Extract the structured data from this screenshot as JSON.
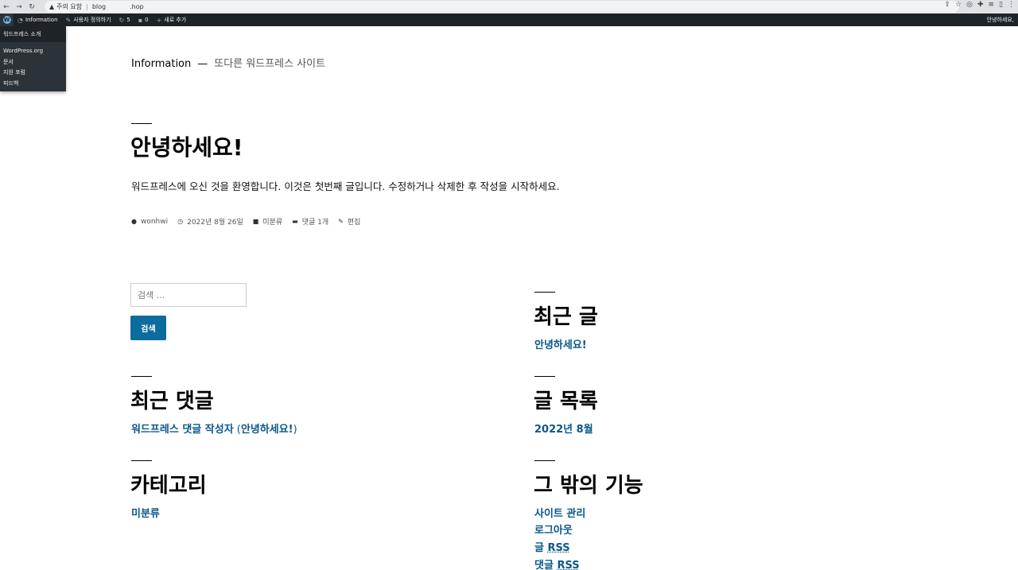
{
  "browser": {
    "warning": "주의 요함",
    "url_left": "blog",
    "url_right": ".hop"
  },
  "adminbar": {
    "site": "Information",
    "customize": "사용자 정의하기",
    "updates": "5",
    "comments": "0",
    "new": "새로 추가",
    "greeting": "안녕하세요,"
  },
  "wpmenu": {
    "about": "워드프레스 소개",
    "items": [
      "WordPress.org",
      "문서",
      "지원 포럼",
      "피드백"
    ]
  },
  "header": {
    "site_title": "Information",
    "separator": "—",
    "description": "또다른 워드프레스 사이트"
  },
  "post": {
    "title": "안녕하세요!",
    "content": "워드프레스에 오신 것을 환영합니다. 이것은 첫번째 글입니다. 수정하거나 삭제한 후 작성을 시작하세요.",
    "meta": {
      "author": "wonhwi",
      "date": "2022년 8월 26일",
      "category": "미분류",
      "comments": "댓글 1개",
      "edit": "편집"
    }
  },
  "search": {
    "placeholder": "검색 ...",
    "button": "검색"
  },
  "widgets": {
    "recent_posts": {
      "title": "최근 글",
      "items": [
        "안녕하세요!"
      ]
    },
    "recent_comments": {
      "title": "최근 댓글",
      "author": "워드프레스 댓글 작성자",
      "on": " (",
      "post": "안녕하세요!",
      "close": ")"
    },
    "archives": {
      "title": "글 목록",
      "items": [
        "2022년 8월"
      ]
    },
    "categories": {
      "title": "카테고리",
      "items": [
        "미분류"
      ]
    },
    "meta": {
      "title": "그 밖의 기능",
      "site_admin": "사이트 관리",
      "logout": "로그아웃",
      "posts_rss_a": "글 ",
      "posts_rss_b": "RSS",
      "comments_rss_a": "댓글 ",
      "comments_rss_b": "RSS"
    }
  }
}
